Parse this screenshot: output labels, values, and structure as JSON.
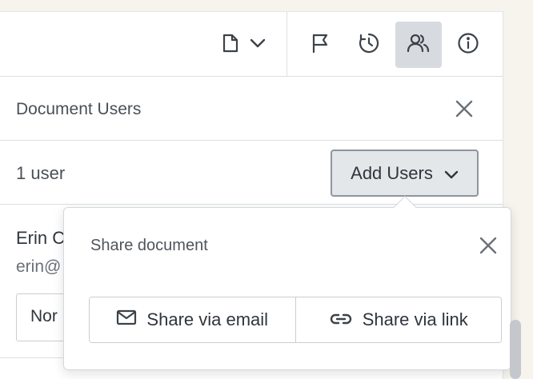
{
  "toolbar": {
    "items": [
      {
        "icon": "document-icon"
      },
      {
        "icon": "chevron-down-icon"
      },
      {
        "icon": "flag-icon"
      },
      {
        "icon": "history-icon"
      },
      {
        "icon": "users-icon",
        "active": true
      },
      {
        "icon": "info-icon"
      }
    ]
  },
  "panel": {
    "title": "Document Users",
    "user_count": "1 user",
    "add_users_label": "Add Users"
  },
  "user": {
    "name": "Erin C",
    "email": "erin@",
    "role": "Nor"
  },
  "share_popover": {
    "title": "Share document",
    "email_label": "Share via email",
    "link_label": "Share via link"
  },
  "colors": {
    "active_tab_bg": "#d7dbe0",
    "button_bg": "#e4e7ea",
    "text": "#2f353c"
  }
}
